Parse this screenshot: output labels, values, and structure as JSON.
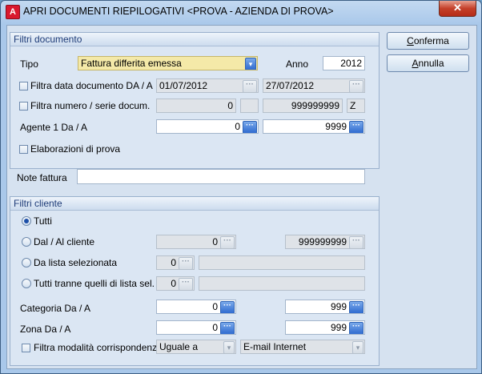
{
  "window": {
    "title": "APRI DOCUMENTI RIEPILOGATIVI <PROVA - AZIENDA DI PROVA>",
    "close_glyph": "✕",
    "icon_glyph": "A"
  },
  "buttons": {
    "conferma_first": "C",
    "conferma_rest": "onferma",
    "annulla_first": "A",
    "annulla_rest": "nnulla"
  },
  "filtri_documento": {
    "header": "Filtri documento",
    "tipo_label": "Tipo",
    "tipo_value": "Fattura differita emessa",
    "anno_label": "Anno",
    "anno_value": "2012",
    "data_label": "Filtra data documento DA / A",
    "data_from": "01/07/2012",
    "data_to": "27/07/2012",
    "numero_label": "Filtra numero / serie docum.",
    "numero_from": "0",
    "numero_to": "999999999",
    "serie_to": "Z",
    "agente_label": "Agente 1 Da / A",
    "agente_from": "0",
    "agente_to": "9999",
    "elaborazioni_label": "Elaborazioni di prova"
  },
  "note": {
    "label": "Note fattura",
    "value": ""
  },
  "filtri_cliente": {
    "header": "Filtri cliente",
    "tutti_label": "Tutti",
    "dal_label": "Dal / Al cliente",
    "dal_from": "0",
    "dal_to": "999999999",
    "lista_label": "Da lista selezionata",
    "lista_value": "0",
    "tranne_label": "Tutti tranne quelli di lista sel.",
    "tranne_value": "0",
    "categoria_label": "Categoria Da / A",
    "categoria_from": "0",
    "categoria_to": "999",
    "zona_label": "Zona Da / A",
    "zona_from": "0",
    "zona_to": "999",
    "modalita_label": "Filtra modalità corrispondenza",
    "modalita_op": "Uguale a",
    "modalita_value": "E-mail Internet"
  },
  "glyphs": {
    "ellipsis": "···",
    "dropdown": "▾"
  }
}
